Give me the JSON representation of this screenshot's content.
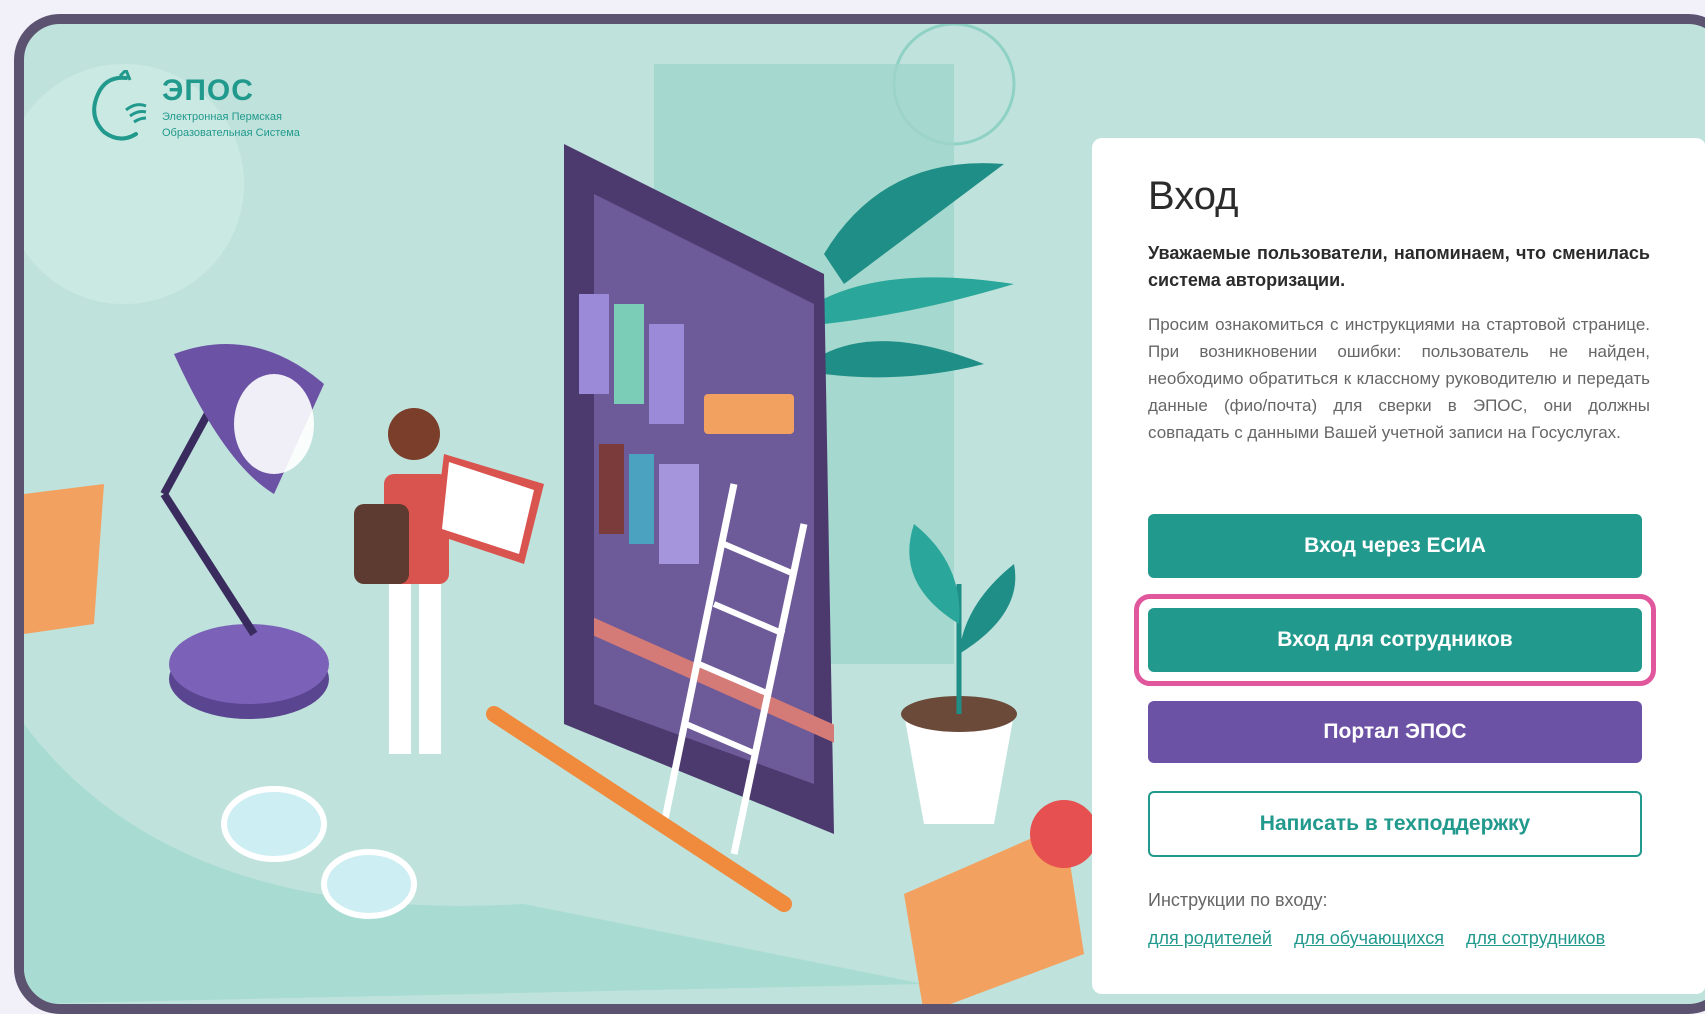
{
  "brand": {
    "name": "ЭПОС",
    "subtitle_line1": "Электронная Пермская",
    "subtitle_line2": "Образовательная Система"
  },
  "login": {
    "title": "Вход",
    "notice": "Уважаемые пользователи, напоминаем, что сменилась система авторизации.",
    "info": "Просим ознакомиться с инструкциями на стартовой странице. При возникновении ошибки: пользователь не найден, необходимо обратиться к классному руководителю и передать данные (фио/почта) для сверки в ЭПОС, они должны совпадать с данными Вашей учетной записи на Госуслугах.",
    "buttons": {
      "esia": "Вход через ЕСИА",
      "staff": "Вход для сотрудников",
      "portal": "Портал ЭПОС",
      "support": "Написать в техподдержку"
    },
    "instructions_label": "Инструкции по входу:",
    "links": [
      "для родителей",
      "для обучающихся",
      "для сотрудников"
    ]
  },
  "colors": {
    "teal": "#21998c",
    "purple": "#6b52a4",
    "highlight": "#e0579d",
    "background": "#bfe3dc"
  }
}
